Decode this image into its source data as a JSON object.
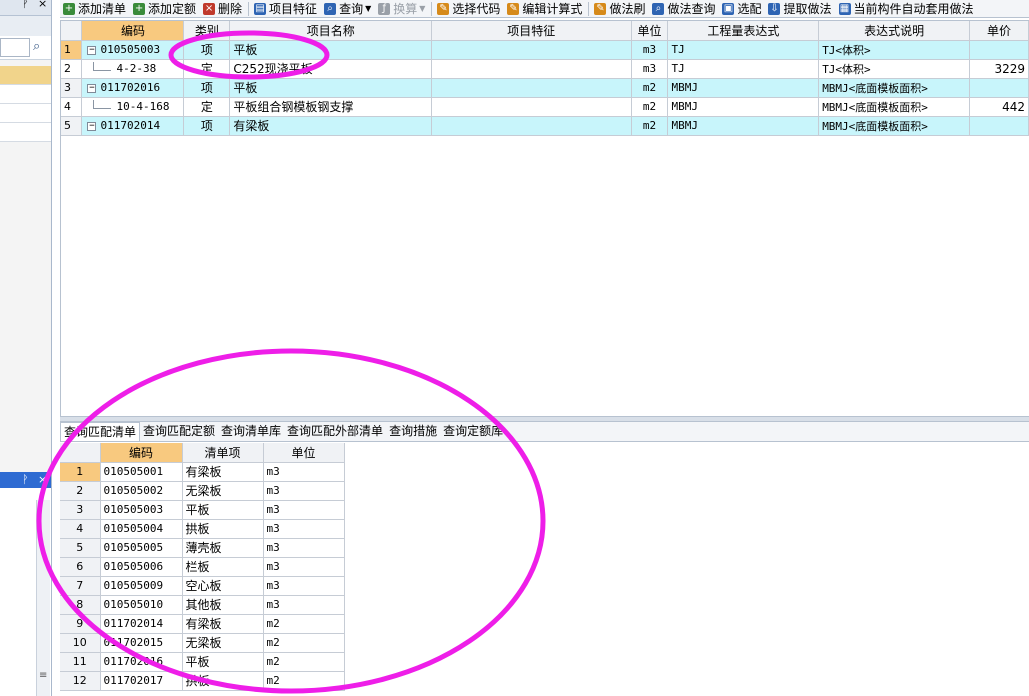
{
  "left_panel": {
    "pin": "ᚹ",
    "close": "×",
    "search_value": ""
  },
  "toolbar": {
    "buttons": [
      {
        "label": "添加清单",
        "icon": "add-bill-icon",
        "color": "#3a8b3a"
      },
      {
        "label": "添加定额",
        "icon": "add-quota-icon",
        "color": "#3a8b3a"
      },
      {
        "label": "删除",
        "icon": "delete-icon",
        "color": "#c0392b"
      },
      {
        "label": "项目特征",
        "icon": "feature-icon",
        "color": "#2e64b3"
      },
      {
        "label": "查询",
        "icon": "query-icon",
        "color": "#2e64b3"
      },
      {
        "label": "换算",
        "icon": "convert-icon",
        "color": "#9aa0a8"
      },
      {
        "label": "选择代码",
        "icon": "select-code-icon",
        "color": "#d68a1a"
      },
      {
        "label": "编辑计算式",
        "icon": "edit-formula-icon",
        "color": "#d68a1a"
      },
      {
        "label": "做法刷",
        "icon": "brush-icon",
        "color": "#d68a1a"
      },
      {
        "label": "做法查询",
        "icon": "method-query-icon",
        "color": "#2e64b3"
      },
      {
        "label": "选配",
        "icon": "match-icon",
        "color": "#2e64b3"
      },
      {
        "label": "提取做法",
        "icon": "extract-icon",
        "color": "#2e64b3"
      },
      {
        "label": "当前构件自动套用做法",
        "icon": "auto-apply-icon",
        "color": "#2e64b3"
      }
    ]
  },
  "main_grid": {
    "headers": [
      "编码",
      "类别",
      "项目名称",
      "项目特征",
      "单位",
      "工程量表达式",
      "表达式说明",
      "单价"
    ],
    "rows": [
      {
        "no": "1",
        "code": "010505003",
        "type": "项",
        "name": "平板",
        "feature": "",
        "unit": "m3",
        "expr": "TJ",
        "desc": "TJ<体积>",
        "price": "",
        "kind": "item"
      },
      {
        "no": "2",
        "code": "4-2-38",
        "type": "定",
        "name": "C252现浇平板",
        "feature": "",
        "unit": "m3",
        "expr": "TJ",
        "desc": "TJ<体积>",
        "price": "3229",
        "kind": "quota"
      },
      {
        "no": "3",
        "code": "011702016",
        "type": "项",
        "name": "平板",
        "feature": "",
        "unit": "m2",
        "expr": "MBMJ",
        "desc": "MBMJ<底面模板面积>",
        "price": "",
        "kind": "item"
      },
      {
        "no": "4",
        "code": "10-4-168",
        "type": "定",
        "name": "平板组合钢模板钢支撑",
        "feature": "",
        "unit": "m2",
        "expr": "MBMJ",
        "desc": "MBMJ<底面模板面积>",
        "price": "442",
        "kind": "quota"
      },
      {
        "no": "5",
        "code": "011702014",
        "type": "项",
        "name": "有梁板",
        "feature": "",
        "unit": "m2",
        "expr": "MBMJ",
        "desc": "MBMJ<底面模板面积>",
        "price": "",
        "kind": "item"
      }
    ]
  },
  "bottom_tabs": [
    "查询匹配清单",
    "查询匹配定额",
    "查询清单库",
    "查询匹配外部清单",
    "查询措施",
    "查询定额库"
  ],
  "bottom_grid": {
    "headers": [
      "编码",
      "清单项",
      "单位"
    ],
    "rows": [
      {
        "no": "1",
        "code": "010505001",
        "name": "有梁板",
        "unit": "m3"
      },
      {
        "no": "2",
        "code": "010505002",
        "name": "无梁板",
        "unit": "m3"
      },
      {
        "no": "3",
        "code": "010505003",
        "name": "平板",
        "unit": "m3"
      },
      {
        "no": "4",
        "code": "010505004",
        "name": "拱板",
        "unit": "m3"
      },
      {
        "no": "5",
        "code": "010505005",
        "name": "薄壳板",
        "unit": "m3"
      },
      {
        "no": "6",
        "code": "010505006",
        "name": "栏板",
        "unit": "m3"
      },
      {
        "no": "7",
        "code": "010505009",
        "name": "空心板",
        "unit": "m3"
      },
      {
        "no": "8",
        "code": "010505010",
        "name": "其他板",
        "unit": "m3"
      },
      {
        "no": "9",
        "code": "011702014",
        "name": "有梁板",
        "unit": "m2"
      },
      {
        "no": "10",
        "code": "011702015",
        "name": "无梁板",
        "unit": "m2"
      },
      {
        "no": "11",
        "code": "011702016",
        "name": "平板",
        "unit": "m2"
      },
      {
        "no": "12",
        "code": "011702017",
        "name": "拱板",
        "unit": "m2"
      }
    ]
  },
  "annotation_color": "#ee1ee8"
}
